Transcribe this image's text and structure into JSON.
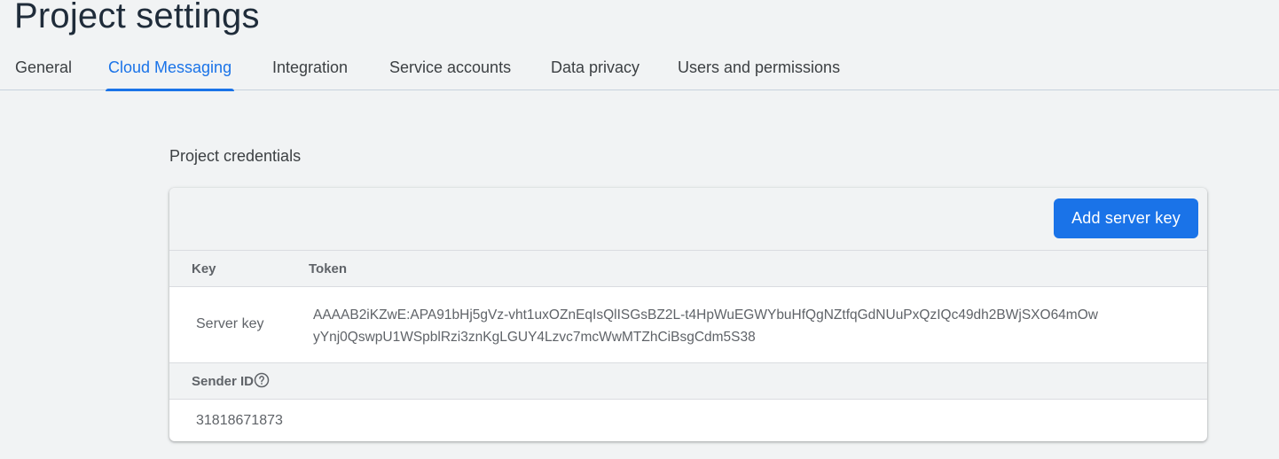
{
  "page": {
    "title": "Project settings"
  },
  "tabs": [
    {
      "label": "General"
    },
    {
      "label": "Cloud Messaging"
    },
    {
      "label": "Integration"
    },
    {
      "label": "Service accounts"
    },
    {
      "label": "Data privacy"
    },
    {
      "label": "Users and permissions"
    }
  ],
  "active_tab": "Cloud Messaging",
  "credentials": {
    "section_title": "Project credentials",
    "add_button_label": "Add server key",
    "table": {
      "headers": {
        "key": "Key",
        "token": "Token"
      },
      "rows": [
        {
          "key": "Server key",
          "token_line1": "AAAAB2iKZwE:APA91bHj5gVz-vht1uxOZnEqIsQlISGsBZ2L-t4HpWuEGWYbuHfQgNZtfqGdNUuPxQzIQc49dh2BWjSXO64mOw",
          "token_line2": "yYnj0QswpU1WSpblRzi3znKgLGUY4Lzvc7mcWwMTZhCiBsgCdm5S38"
        }
      ]
    },
    "sender": {
      "label": "Sender ID",
      "value": "31818671873"
    }
  },
  "colors": {
    "accent": "#1a73e8",
    "background": "#f1f3f4",
    "title": "#1f2c3a",
    "text": "#3c4043",
    "muted": "#5f6368"
  },
  "icons": {
    "help": "help-circle-icon"
  }
}
